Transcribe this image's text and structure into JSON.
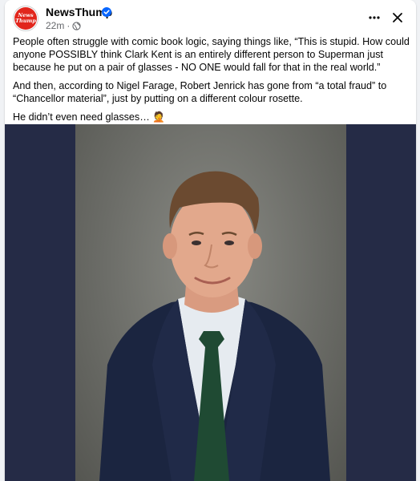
{
  "post": {
    "page_name": "NewsThump",
    "avatar_text": [
      "News",
      "Thump"
    ],
    "time": "22m",
    "dot": "·",
    "paragraphs": [
      "People often struggle with comic book logic, saying things like, “This is stupid. How could anyone POSSIBLY think Clark Kent is an entirely different person to Superman just because he put on a pair of glasses - NO ONE would fall for that in the real world.”",
      "And then, according to Nigel Farage, Robert Jenrick has gone from “a total fraud” to “Chancellor material”, just by putting on a different colour rosette.",
      "He didn’t even need glasses… 🤦"
    ]
  },
  "icons": {
    "verified": "verified-badge-icon",
    "privacy": "globe-icon",
    "more": "more-horizontal-icon",
    "close": "close-icon"
  },
  "colors": {
    "brand_red": "#e1261c",
    "verified_blue": "#0866ff",
    "media_background": "#252b46",
    "secondary_text": "#65676b"
  }
}
